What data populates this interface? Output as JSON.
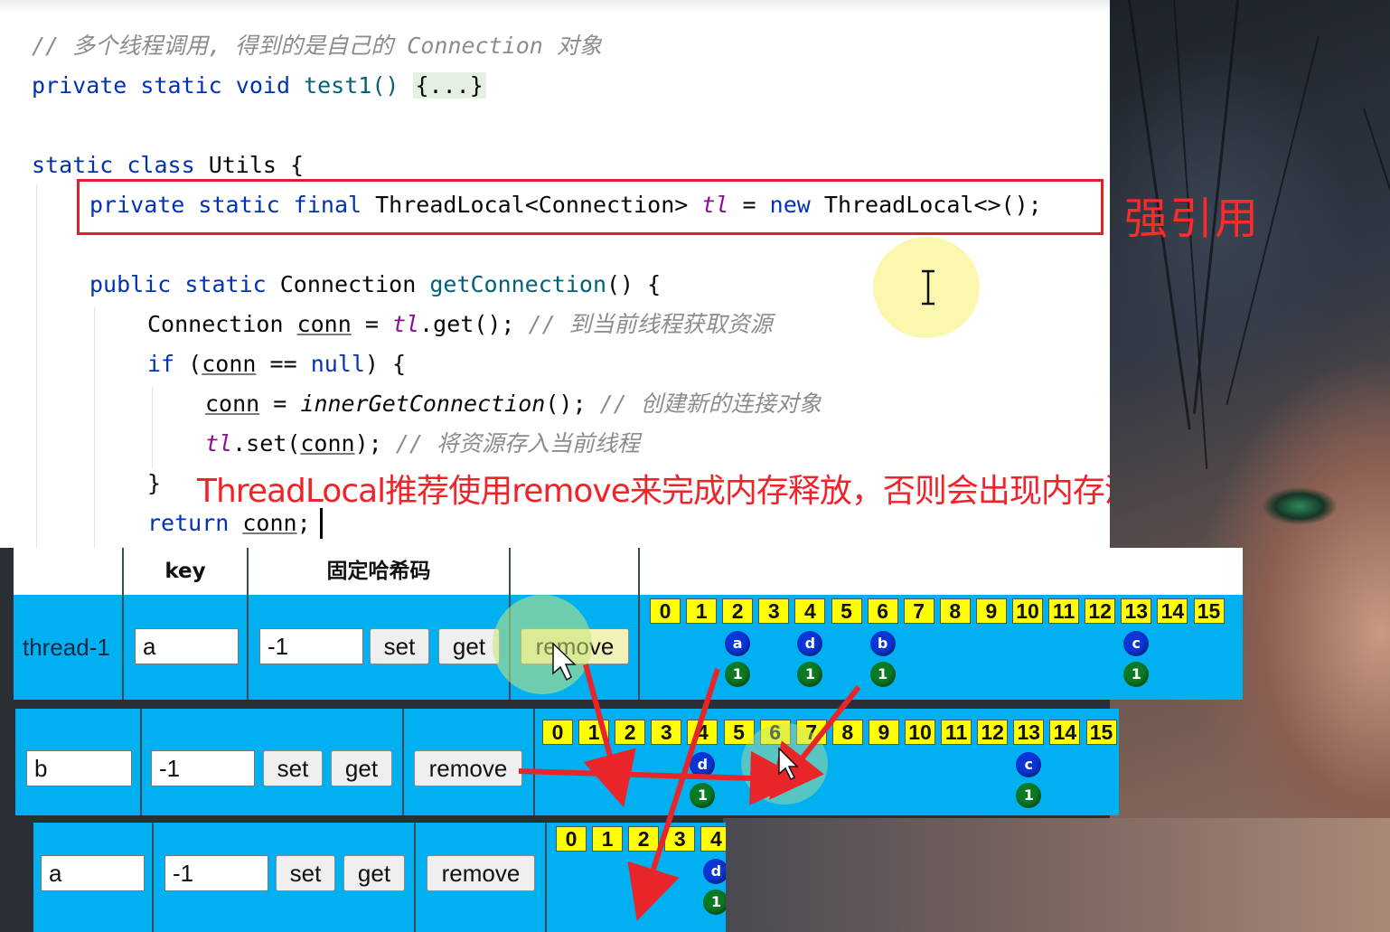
{
  "editor": {
    "lines": {
      "comment1": "// 多个线程调用, 得到的是自己的 Connection 对象",
      "method_private": "private",
      "method_static": "static",
      "method_void": "void",
      "method_name": "test1()",
      "method_fold": "{...}",
      "class_static": "static",
      "class_kw": "class",
      "class_name": "Utils {",
      "field_private": "private",
      "field_static": "static",
      "field_final": "final",
      "field_type": "ThreadLocal<Connection>",
      "field_name": "tl",
      "field_eq": "=",
      "field_new": "new",
      "field_init": "ThreadLocal<>();",
      "get_public": "public",
      "get_static": "static",
      "get_type": "Connection",
      "get_name": "getConnection",
      "get_tail": "() {",
      "conn_type": "Connection",
      "conn_var": "conn",
      "conn_eq": "=",
      "conn_tl": "tl",
      "conn_get": ".get();",
      "conn_comment": "// 到当前线程获取资源",
      "if_kw": "if",
      "if_open": "(",
      "if_var": "conn",
      "if_op": "==",
      "if_null": "null",
      "if_close": ") {",
      "inner_var": "conn",
      "inner_eq": "=",
      "inner_call": "innerGetConnection",
      "inner_tail": "();",
      "inner_comment": "// 创建新的连接对象",
      "set_tl": "tl",
      "set_call": ".set(",
      "set_arg": "conn",
      "set_tail": ");",
      "set_comment": "// 将资源存入当前线程",
      "close_brace": "}",
      "return_kw": "return",
      "return_var": "conn",
      "return_tail": ";"
    },
    "annotations": {
      "strong_ref": "强引用",
      "memory_note": "ThreadLocal推荐使用remove来完成内存释放，否则会出现内存泄漏"
    },
    "colors": {
      "keyword": "#0033b3",
      "comment": "#8c8c8c",
      "field": "#871094",
      "annotation": "#f0222a"
    }
  },
  "demo": {
    "headers": {
      "key": "key",
      "hash": "固定哈希码"
    },
    "rows": [
      {
        "thread": "thread-1",
        "key_value": "a",
        "hash_value": "-1",
        "set_label": "set",
        "get_label": "get",
        "remove_label": "remove",
        "slots": [
          "0",
          "1",
          "2",
          "3",
          "4",
          "5",
          "6",
          "7",
          "8",
          "9",
          "10",
          "11",
          "12",
          "13",
          "14",
          "15"
        ],
        "entries": [
          {
            "slot": 2,
            "key": "a",
            "value": "1"
          },
          {
            "slot": 4,
            "key": "d",
            "value": "1"
          },
          {
            "slot": 6,
            "key": "b",
            "value": "1"
          },
          {
            "slot": 13,
            "key": "c",
            "value": "1"
          }
        ]
      },
      {
        "key_value": "b",
        "hash_value": "-1",
        "set_label": "set",
        "get_label": "get",
        "remove_label": "remove",
        "slots": [
          "0",
          "1",
          "2",
          "3",
          "4",
          "5",
          "6",
          "7",
          "8",
          "9",
          "10",
          "11",
          "12",
          "13",
          "14",
          "15"
        ],
        "entries": [
          {
            "slot": 4,
            "key": "d",
            "value": "1"
          },
          {
            "slot": 13,
            "key": "c",
            "value": "1"
          }
        ]
      },
      {
        "key_value": "a",
        "hash_value": "-1",
        "set_label": "set",
        "get_label": "get",
        "remove_label": "remove",
        "slots": [
          "0",
          "1",
          "2",
          "3",
          "4"
        ],
        "entries": [
          {
            "slot": 4,
            "key": "d",
            "value": "1"
          }
        ]
      }
    ],
    "colors": {
      "table_bg": "#00b0f0",
      "slot_bg": "#ffff00",
      "key_dot": "#0a36d8",
      "value_dot": "#0b7a24",
      "arrow": "#e8262a"
    }
  }
}
